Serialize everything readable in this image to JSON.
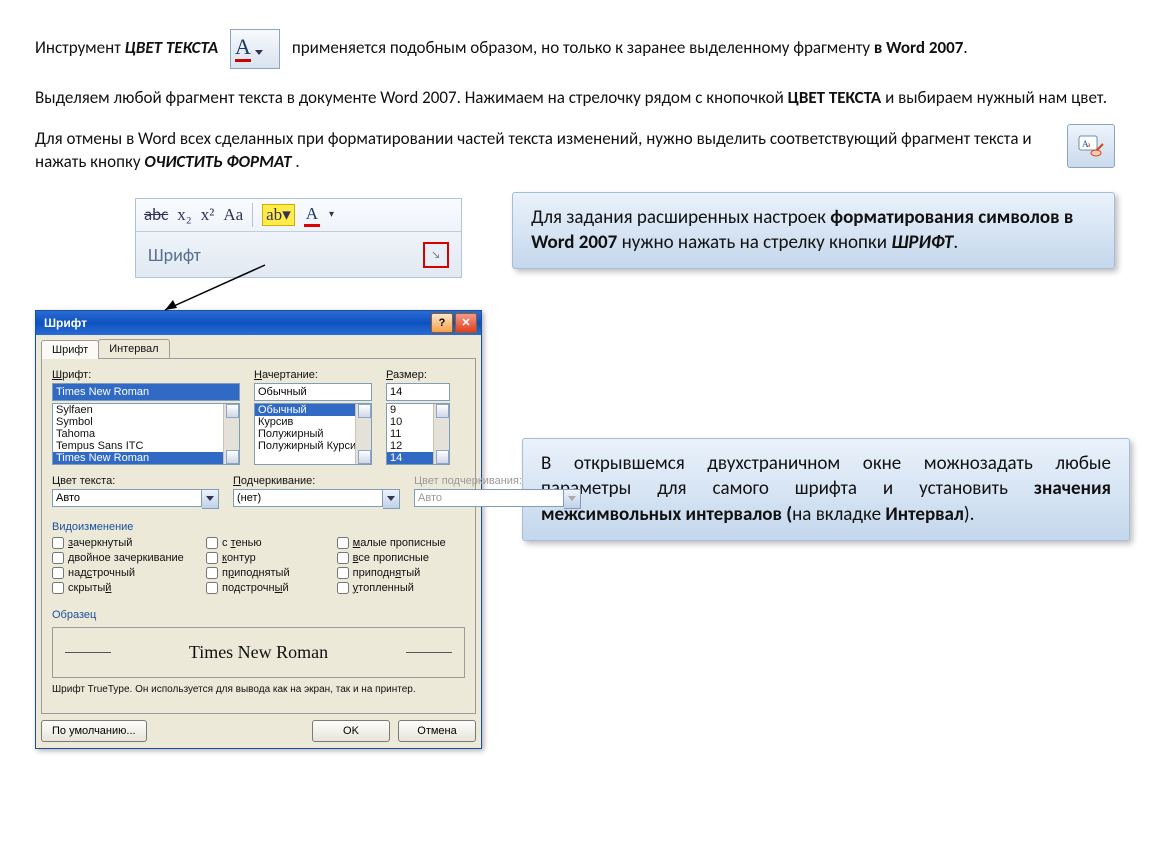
{
  "para1": {
    "prefix": "Инструмент  ",
    "tool": "ЦВЕТ  ТЕКСТА",
    "middle": "применяется  подобным  образом,  но   только  к заранее выделенному фрагменту ",
    "suffix_bold": "в Word 2007",
    "period": "."
  },
  "fontcolor_btn": {
    "glyph": "A"
  },
  "para2": {
    "t1": "Выделяем любой фрагмент текста в документе Word 2007. Нажимаем на стрелочку рядом с кнопочкой ",
    "b1": "ЦВЕТ ТЕКСТА",
    "t2": " и выбираем нужный нам цвет."
  },
  "para3": {
    "t1": "Для отмены в Word всех сделанных при форматировании частей текста изменений, нужно выделить соответствующий фрагмент текста и нажать кнопку ",
    "b1": "ОЧИСТИТЬ  ФОРМАТ",
    "t2": " ."
  },
  "clear_fmt_label": "Aa",
  "ribbon": {
    "strike": "abc",
    "sub": "x₂",
    "sup": "x²",
    "aA": "Aa",
    "hl": "ab",
    "A": "A",
    "group": "Шрифт",
    "launcher": "↘"
  },
  "box1": {
    "t1": "Для задания расширенных настроек ",
    "b1": "форматирования символов в Word 2007",
    "t2": " нужно нажать на стрелку кнопки ",
    "b2": "ШРИФТ",
    "t3": "."
  },
  "box2": {
    "t1": "  В  открывшемся  двухстраничном  окне можно",
    "t1b": "задать любые параметры для самого шрифта и установить ",
    "b1": "значения межсимвольных интервалов (",
    "t2": "на вкладке ",
    "b2": "Интервал",
    "t3": ")."
  },
  "dlg": {
    "title": "Шрифт",
    "help": "?",
    "close": "✕",
    "tab1": "Шрифт",
    "tab2": "Интервал",
    "font_label": "Шрифт:",
    "font_value": "Times New Roman",
    "font_list": [
      "Sylfaen",
      "Symbol",
      "Tahoma",
      "Tempus Sans ITC",
      "Times New Roman"
    ],
    "style_label": "Начертание:",
    "style_value": "Обычный",
    "style_list": [
      "Обычный",
      "Курсив",
      "Полужирный",
      "Полужирный Курсив"
    ],
    "size_label": "Размер:",
    "size_value": "14",
    "size_list": [
      "9",
      "10",
      "11",
      "12",
      "14"
    ],
    "color_label": "Цвет текста:",
    "color_value": "Авто",
    "under_label": "Подчеркивание:",
    "under_value": "(нет)",
    "ucolor_label": "Цвет подчеркивания:",
    "ucolor_value": "Авто",
    "effects_title": "Видоизменение",
    "effects": {
      "strike": "зачеркнутый",
      "dstrike": "двойное зачеркивание",
      "sup": "надстрочный",
      "sub": "подстрочный",
      "shadow": "с тенью",
      "outline": "контур",
      "emboss": "приподнятый",
      "engrave": "утопленный",
      "smallcaps": "малые прописные",
      "allcaps": "все прописные",
      "hidden": "скрытый"
    },
    "sample_title": "Образец",
    "sample_text": "Times New Roman",
    "note": "Шрифт TrueType. Он используется для вывода как на экран, так и на принтер.",
    "default_btn": "По умолчанию...",
    "ok": "OK",
    "cancel": "Отмена"
  }
}
